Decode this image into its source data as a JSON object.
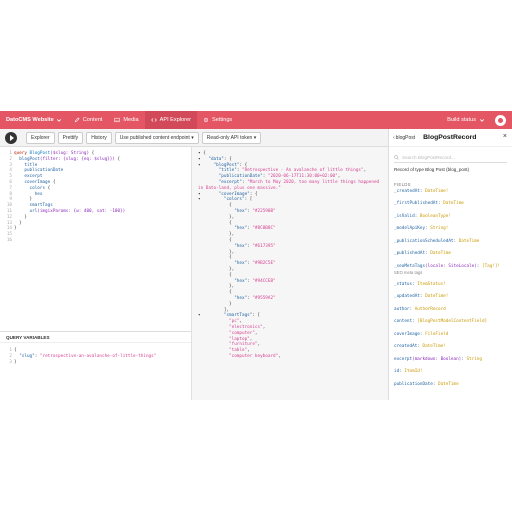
{
  "topbar": {
    "site_name": "DatoCMS Website",
    "nav": [
      {
        "label": "Content"
      },
      {
        "label": "Media"
      },
      {
        "label": "API Explorer"
      },
      {
        "label": "Settings"
      }
    ],
    "build_status": "Build status",
    "accent": "#e45664"
  },
  "toolbar": {
    "buttons": [
      "Explorer",
      "Prettify",
      "History",
      "Use published content endpoint",
      "Read-only API token"
    ]
  },
  "query_editor": {
    "line_numbers": [
      "1",
      "2",
      "3",
      "4",
      "5",
      "6",
      "7",
      "8",
      "9",
      "10",
      "11",
      "12",
      "13",
      "14",
      "15",
      "16"
    ]
  },
  "query_variables": {
    "title": "QUERY VARIABLES",
    "line_numbers": [
      "1",
      "2",
      "3"
    ]
  },
  "docs": {
    "back_label": "blogPost",
    "title": "BlogPostRecord",
    "search_placeholder": "Search BlogPostRecord...",
    "description": "Record of type Blog Post (blog_post)",
    "fields_header": "FIELDS",
    "fields": [
      {
        "name": "_createdAt",
        "args": "",
        "type": "DateTime!",
        "sub": ""
      },
      {
        "name": "_firstPublishedAt",
        "args": "",
        "type": "DateTime",
        "sub": ""
      },
      {
        "name": "_isValid",
        "args": "",
        "type": "BooleanType!",
        "sub": ""
      },
      {
        "name": "_modelApiKey",
        "args": "",
        "type": "String!",
        "sub": ""
      },
      {
        "name": "_publicationScheduledAt",
        "args": "",
        "type": "DateTime",
        "sub": ""
      },
      {
        "name": "_publishedAt",
        "args": "",
        "type": "DateTime",
        "sub": ""
      },
      {
        "name": "_seoMetaTags",
        "args": "(locale: SiteLocale)",
        "type": "[Tag!]!",
        "sub": "SEO meta tags"
      },
      {
        "name": "_status",
        "args": "",
        "type": "ItemStatus!",
        "sub": ""
      },
      {
        "name": "_updatedAt",
        "args": "",
        "type": "DateTime!",
        "sub": ""
      },
      {
        "name": "author",
        "args": "",
        "type": "AuthorRecord",
        "sub": ""
      },
      {
        "name": "content",
        "args": "",
        "type": "[BlogPostModelContentField]",
        "sub": ""
      },
      {
        "name": "coverImage",
        "args": "",
        "type": "FileField",
        "sub": ""
      },
      {
        "name": "createdAt",
        "args": "",
        "type": "DateTime!",
        "sub": ""
      },
      {
        "name": "excerpt",
        "args": "(markdown: Boolean)",
        "type": "String",
        "sub": ""
      },
      {
        "name": "id",
        "args": "",
        "type": "ItemId!",
        "sub": ""
      },
      {
        "name": "publicationDate",
        "args": "",
        "type": "DateTime",
        "sub": ""
      }
    ]
  },
  "code": {
    "q_query": "query",
    "q_opname": "BlogPost",
    "q_vardecl": "($slug: String)",
    "q_field": "blogPost",
    "q_filter": "(filter: {slug: {eq: $slug}})",
    "title": "title",
    "publicationDate": "publicationDate",
    "excerpt": "excerpt",
    "coverImage": "coverImage",
    "colors": "colors",
    "hex": "hex",
    "smartTags": "smartTags",
    "url_name": "url",
    "url_args": "(imgixParams: {w: 400, sat: -100})",
    "v_key": "\"slug\"",
    "v_val": "\"retrospective-an-avalanche-of-little-things\"",
    "r_data": "\"data\"",
    "r_blogPost": "\"blogPost\"",
    "r_title_k": "\"title\"",
    "r_title_v": "\"Retrospective - An avalanche of little things\"",
    "r_pub_k": "\"publicationDate\"",
    "r_pub_v": "\"2020-06-17T11:30:00+02:00\"",
    "r_exc_k": "\"excerpt\"",
    "r_exc_v1": "\"March to May 2020, too many little things happened",
    "r_exc_v2": "in Dato-land, plus one massive.\"",
    "r_cover_k": "\"coverImage\"",
    "r_colors_k": "\"colors\"",
    "r_hex_k": "\"hex\"",
    "hex_values": [
      "\"#22590B\"",
      "\"#8C8B8C\"",
      "\"#617395\"",
      "\"#9B2C5E\"",
      "\"#94CCEB\"",
      "\"#9559A2\""
    ],
    "r_smart_k": "\"smartTags\"",
    "smart_tags": [
      "\"pc\"",
      "\"electronics\"",
      "\"computer\"",
      "\"laptop\"",
      "\"furniture\"",
      "\"table\"",
      "\"computer keyboard\""
    ]
  }
}
